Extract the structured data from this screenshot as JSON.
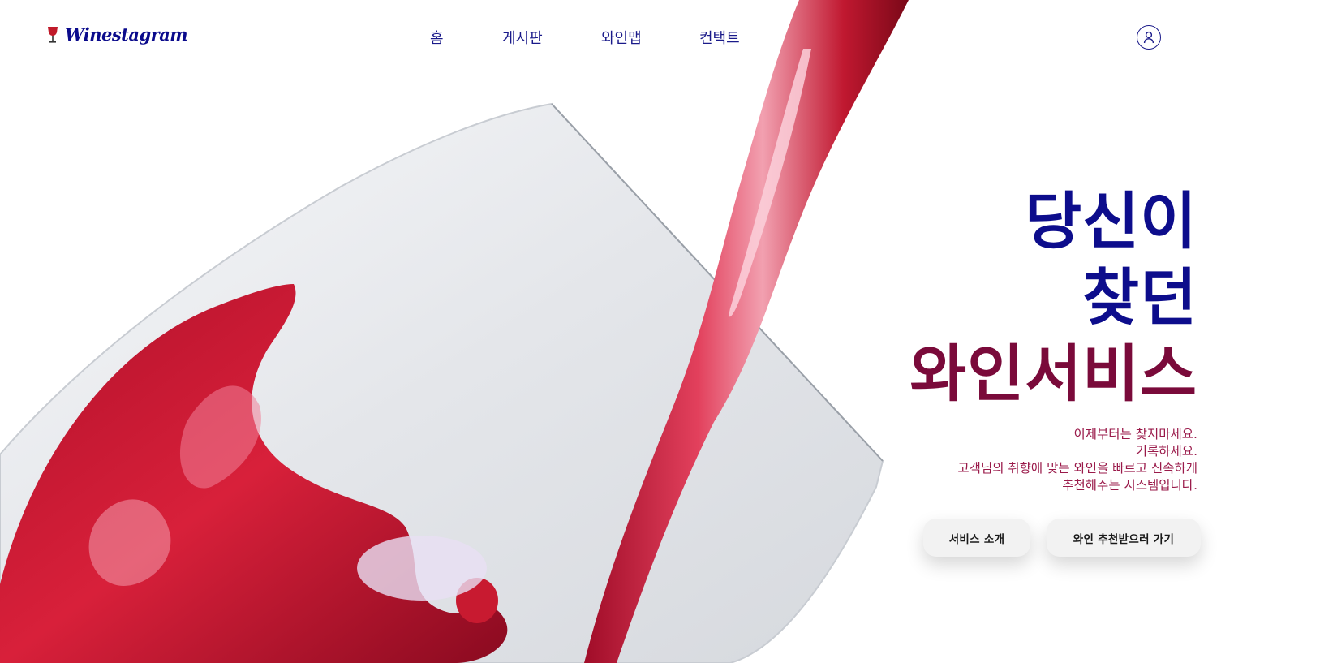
{
  "header": {
    "logo_text": "Winestagram",
    "nav": [
      "홈",
      "게시판",
      "와인맵",
      "컨택트"
    ]
  },
  "hero": {
    "headline": [
      "당신이",
      "찾던",
      "와인서비스"
    ],
    "description": [
      "이제부터는 찾지마세요.",
      "기록하세요.",
      "고객님의 취향에 맞는 와인을 빠르고 신속하게",
      "추천해주는 시스템입니다."
    ],
    "buttons": {
      "intro": "서비스 소개",
      "recommend": "와인 추천받으러 가기"
    }
  },
  "colors": {
    "navy": "#0d0d8c",
    "wine": "#7a0a3a",
    "accent": "#9a1a4a"
  },
  "icons": {
    "logo": "wine-glass-icon",
    "user": "user-icon"
  }
}
